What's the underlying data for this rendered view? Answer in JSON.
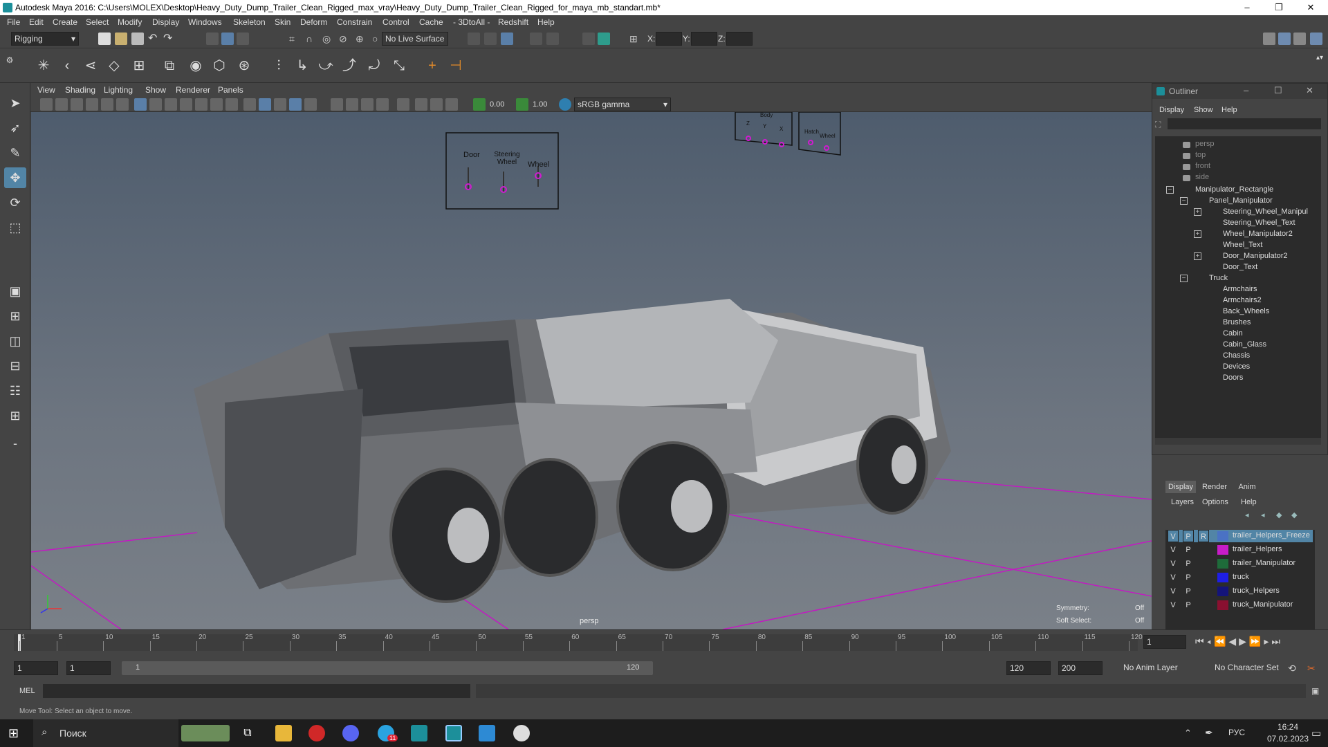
{
  "window": {
    "title": "Autodesk Maya 2016: C:\\Users\\MOLEX\\Desktop\\Heavy_Duty_Dump_Trailer_Clean_Rigged_max_vray\\Heavy_Duty_Dump_Trailer_Clean_Rigged_for_maya_mb_standart.mb*",
    "minimize": "–",
    "maximize": "❐",
    "close": "✕"
  },
  "menu": [
    "File",
    "Edit",
    "Create",
    "Select",
    "Modify",
    "Display",
    "Windows",
    "Skeleton",
    "Skin",
    "Deform",
    "Constrain",
    "Control",
    "Cache",
    "- 3DtoAll -",
    "Redshift",
    "Help"
  ],
  "status": {
    "mode": "Rigging",
    "live_surface": "No Live Surface",
    "x_label": "X:",
    "y_label": "Y:",
    "z_label": "Z:"
  },
  "viewport": {
    "menu": [
      "View",
      "Shading",
      "Lighting",
      "Show",
      "Renderer",
      "Panels"
    ],
    "exposure": "0.00",
    "gamma": "1.00",
    "color_space": "sRGB gamma",
    "camera_label": "persp",
    "symmetry_label": "Symmetry:",
    "symmetry_value": "Off",
    "soft_select_label": "Soft Select:",
    "soft_select_value": "Off",
    "panel1": {
      "labels": [
        "Door",
        "Steering Wheel",
        "Wheel"
      ]
    },
    "panel2": {
      "labels": [
        "Z",
        "Y",
        "X",
        "Hatch",
        "Wheel"
      ],
      "top_label": "Body"
    }
  },
  "outliner": {
    "title": "Outliner",
    "menu": [
      "Display",
      "Show",
      "Help"
    ],
    "items": [
      {
        "label": "persp",
        "dim": true
      },
      {
        "label": "top",
        "dim": true
      },
      {
        "label": "front",
        "dim": true
      },
      {
        "label": "side",
        "dim": true
      },
      {
        "label": "Manipulator_Rectangle"
      },
      {
        "label": "Panel_Manipulator"
      },
      {
        "label": "Steering_Wheel_Manipul"
      },
      {
        "label": "Steering_Wheel_Text"
      },
      {
        "label": "Wheel_Manipulator2"
      },
      {
        "label": "Wheel_Text"
      },
      {
        "label": "Door_Manipulator2"
      },
      {
        "label": "Door_Text"
      },
      {
        "label": "Truck"
      },
      {
        "label": "Armchairs"
      },
      {
        "label": "Armchairs2"
      },
      {
        "label": "Back_Wheels"
      },
      {
        "label": "Brushes"
      },
      {
        "label": "Cabin"
      },
      {
        "label": "Cabin_Glass"
      },
      {
        "label": "Chassis"
      },
      {
        "label": "Devices"
      },
      {
        "label": "Doors"
      }
    ]
  },
  "layers": {
    "tabs": [
      "Display",
      "Render",
      "Anim"
    ],
    "menu": [
      "Layers",
      "Options",
      "Help"
    ],
    "header": {
      "v": "V",
      "p": "P",
      "r": "R"
    },
    "rows": [
      {
        "v": "V",
        "p": "P",
        "name": "trailer_Helpers_Freeze",
        "color": "#4a72c4",
        "selected": true
      },
      {
        "v": "V",
        "p": "P",
        "name": "trailer_Helpers",
        "color": "#c81cc8"
      },
      {
        "v": "V",
        "p": "P",
        "name": "trailer_Manipulator",
        "color": "#1e6b3a"
      },
      {
        "v": "V",
        "p": "P",
        "name": "truck",
        "color": "#1e1ee6"
      },
      {
        "v": "V",
        "p": "P",
        "name": "truck_Helpers",
        "color": "#14147a"
      },
      {
        "v": "V",
        "p": "P",
        "name": "truck_Manipulator",
        "color": "#8a1030"
      }
    ]
  },
  "timeline": {
    "ticks": [
      "1",
      "5",
      "10",
      "15",
      "20",
      "25",
      "30",
      "35",
      "40",
      "45",
      "50",
      "55",
      "60",
      "65",
      "70",
      "75",
      "80",
      "85",
      "90",
      "95",
      "100",
      "105",
      "110",
      "115",
      "120"
    ],
    "current_frame": "1"
  },
  "range": {
    "start": "1",
    "playback_start": "1",
    "slider_start": "1",
    "slider_end": "120",
    "playback_end": "120",
    "end": "200",
    "anim_layer": "No Anim Layer",
    "char_set": "No Character Set"
  },
  "command": {
    "label": "MEL"
  },
  "help_line": "Move Tool: Select an object to move.",
  "taskbar": {
    "search": "Поиск",
    "lang": "РУС",
    "time": "16:24",
    "date": "07.02.2023",
    "telegram_badge": "11"
  }
}
